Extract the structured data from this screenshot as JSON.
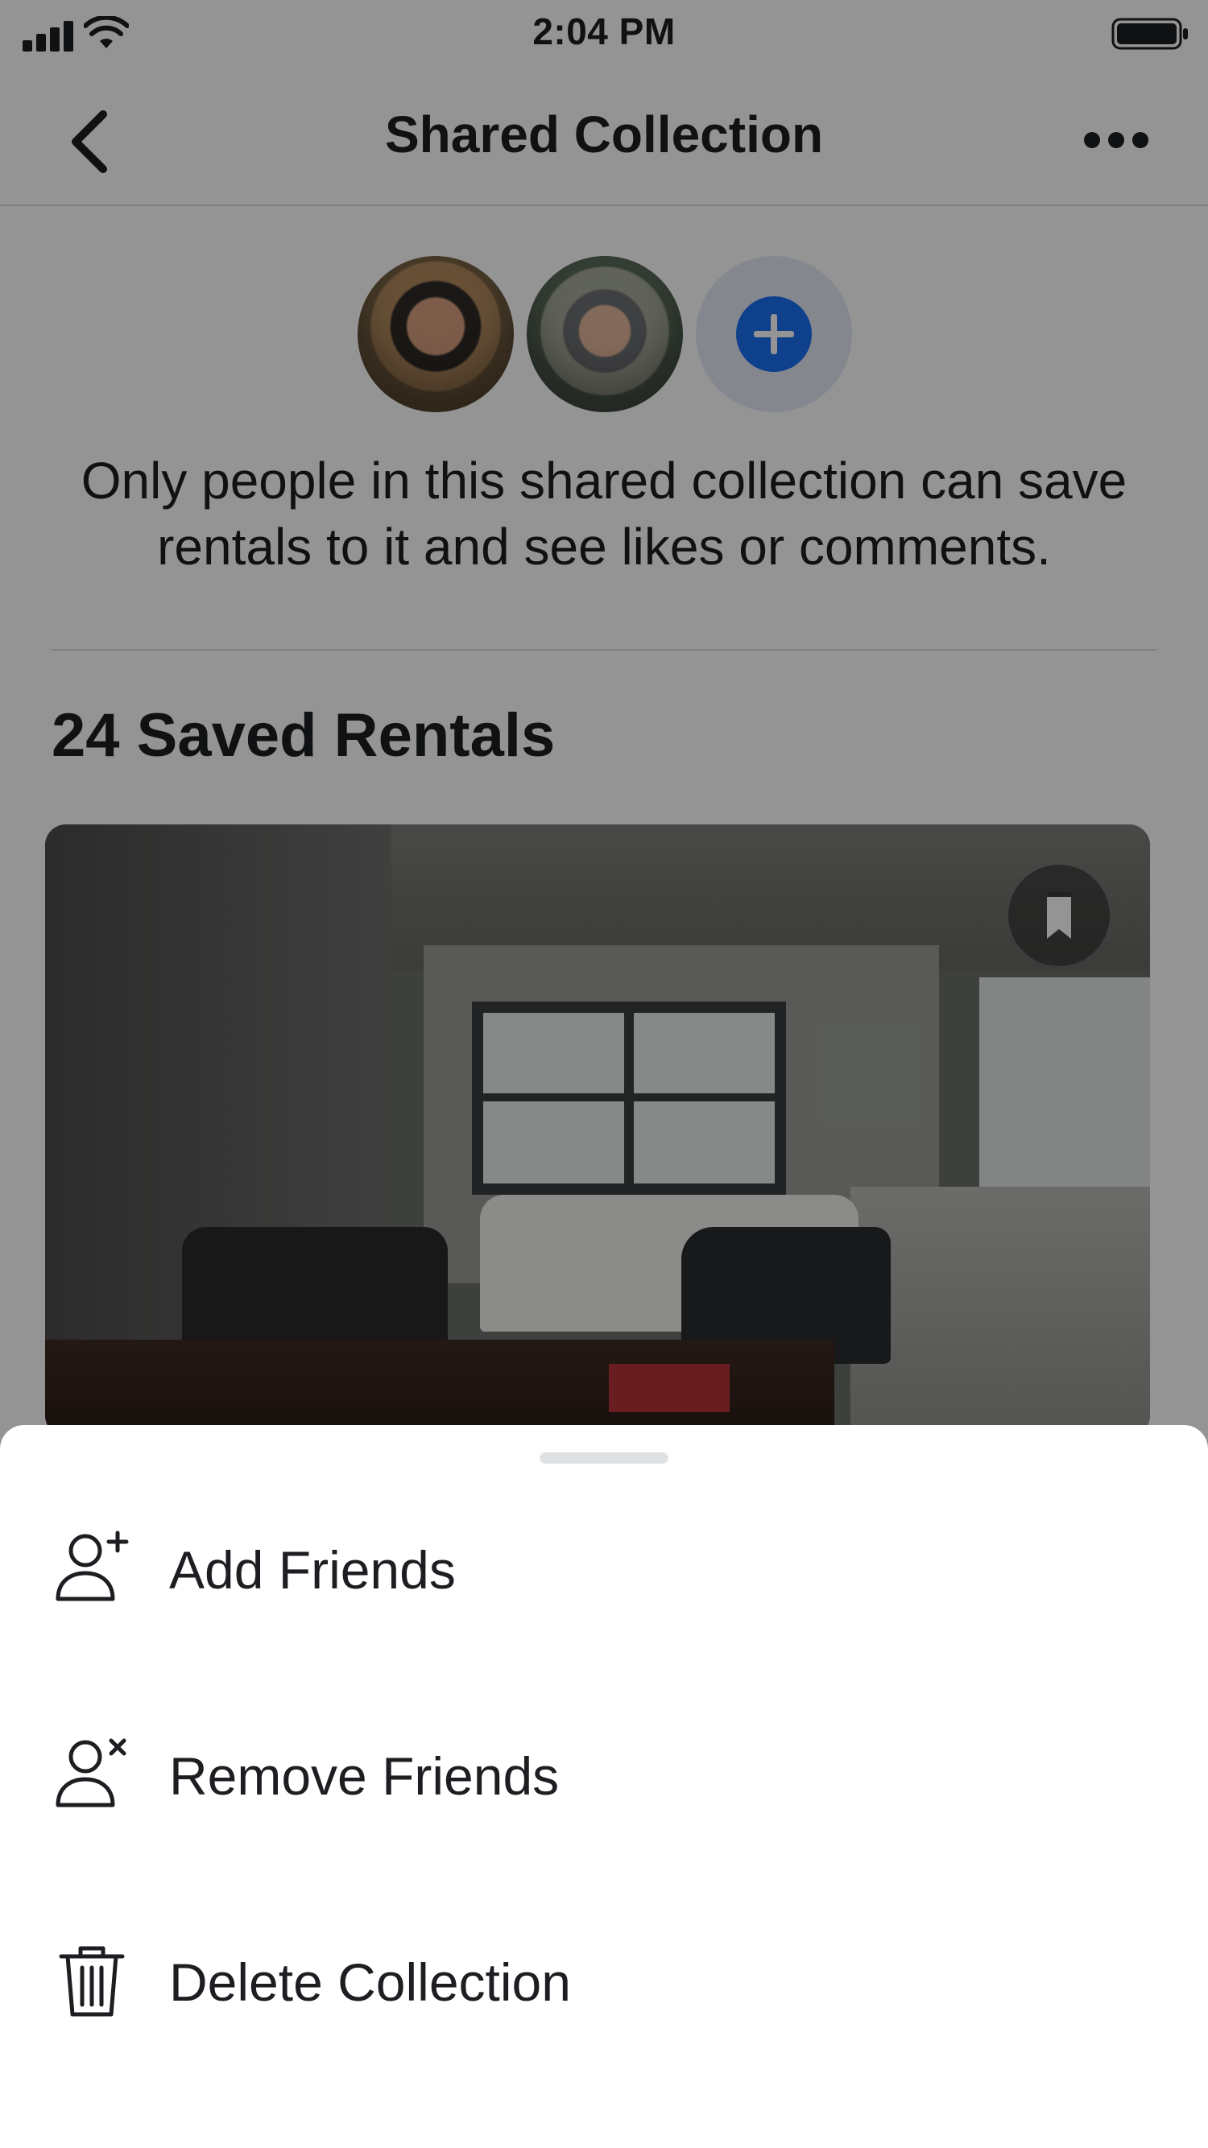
{
  "status_bar": {
    "time": "2:04 PM",
    "icons": [
      "cellular-signal-icon",
      "wifi-icon",
      "battery-icon"
    ]
  },
  "nav": {
    "title": "Shared Collection",
    "back_icon": "chevron-left-icon",
    "more_icon": "more-horizontal-icon"
  },
  "members": {
    "avatars": [
      "avatar-member-1",
      "avatar-member-2"
    ],
    "add_icon": "plus-circle-icon"
  },
  "description": "Only people in this shared collection can save rentals to it and see likes or comments.",
  "saved": {
    "heading": "24 Saved Rentals",
    "card_icon": "bookmark-icon"
  },
  "sheet": {
    "items": [
      {
        "label": "Add Friends",
        "icon": "add-person-icon"
      },
      {
        "label": "Remove Friends",
        "icon": "remove-person-icon"
      },
      {
        "label": "Delete Collection",
        "icon": "trash-icon"
      }
    ]
  },
  "colors": {
    "accent": "#1b6ff0",
    "text": "#1c1e21",
    "divider": "#d9dbde",
    "overlay": "rgba(0,0,0,0.42)"
  }
}
